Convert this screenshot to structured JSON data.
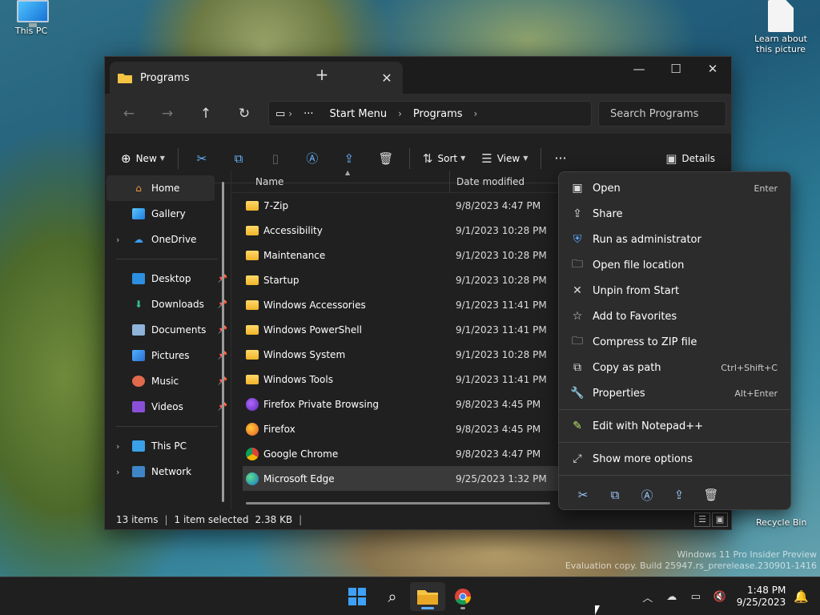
{
  "desktop": {
    "this_pc": "This PC",
    "learn": "Learn about this picture",
    "recycle": "Recycle Bin",
    "watermark_line1": "Windows 11 Pro Insider Preview",
    "watermark_line2": "Evaluation copy. Build 25947.rs_prerelease.230901-1416"
  },
  "window": {
    "tab_title": "Programs",
    "new_tab": "+",
    "close_tab": "✕",
    "minimize": "—",
    "maximize": "☐",
    "close": "✕"
  },
  "address": {
    "more": "···",
    "crumbs": [
      "Start Menu",
      "Programs"
    ],
    "search_placeholder": "Search Programs"
  },
  "toolbar": {
    "new_label": "New",
    "sort_label": "Sort",
    "view_label": "View",
    "more": "···",
    "details_label": "Details"
  },
  "sidebar": {
    "home": "Home",
    "gallery": "Gallery",
    "onedrive": "OneDrive",
    "desktop": "Desktop",
    "downloads": "Downloads",
    "documents": "Documents",
    "pictures": "Pictures",
    "music": "Music",
    "videos": "Videos",
    "this_pc": "This PC",
    "network": "Network"
  },
  "files": {
    "col_name": "Name",
    "col_date": "Date modified",
    "rows": [
      {
        "name": "7-Zip",
        "date": "9/8/2023 4:47 PM"
      },
      {
        "name": "Accessibility",
        "date": "9/1/2023 10:28 PM"
      },
      {
        "name": "Maintenance",
        "date": "9/1/2023 10:28 PM"
      },
      {
        "name": "Startup",
        "date": "9/1/2023 10:28 PM"
      },
      {
        "name": "Windows Accessories",
        "date": "9/1/2023 11:41 PM"
      },
      {
        "name": "Windows PowerShell",
        "date": "9/1/2023 11:41 PM"
      },
      {
        "name": "Windows System",
        "date": "9/1/2023 10:28 PM"
      },
      {
        "name": "Windows Tools",
        "date": "9/1/2023 11:41 PM"
      },
      {
        "name": "Firefox Private Browsing",
        "date": "9/8/2023 4:45 PM"
      },
      {
        "name": "Firefox",
        "date": "9/8/2023 4:45 PM"
      },
      {
        "name": "Google Chrome",
        "date": "9/8/2023 4:47 PM"
      },
      {
        "name": "Microsoft Edge",
        "date": "9/25/2023 1:32 PM"
      }
    ]
  },
  "status": {
    "count": "13 items",
    "selected": "1 item selected",
    "size": "2.38 KB"
  },
  "context_menu": {
    "open": "Open",
    "open_sc": "Enter",
    "share": "Share",
    "run_admin": "Run as administrator",
    "open_location": "Open file location",
    "unpin": "Unpin from Start",
    "favorites": "Add to Favorites",
    "compress": "Compress to ZIP file",
    "copy_path": "Copy as path",
    "copy_path_sc": "Ctrl+Shift+C",
    "properties": "Properties",
    "properties_sc": "Alt+Enter",
    "notepad": "Edit with Notepad++",
    "more_options": "Show more options"
  },
  "taskbar": {
    "time": "1:48 PM",
    "date": "9/25/2023"
  },
  "colors": {
    "accent": "#60b0ff",
    "folder": "#f0b429"
  }
}
